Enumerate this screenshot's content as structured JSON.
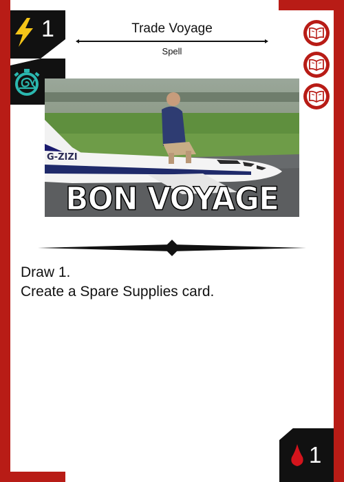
{
  "card": {
    "title": "Trade Voyage",
    "type": "Spell",
    "energy": "1",
    "cost": "1",
    "art_caption": "BON VOYAGE",
    "art_plane_marking": "G-ZIZI",
    "body_lines": [
      "Draw 1.",
      "Create a Spare Supplies card."
    ]
  },
  "icons": {
    "energy": "lightning-bolt-icon",
    "speed": "stopwatch-snail-icon",
    "badges": [
      "open-book-icon",
      "open-book-icon",
      "open-book-icon"
    ],
    "cost": "blood-drop-icon"
  },
  "colors": {
    "frame_red": "#b81c16",
    "panel_black": "#111111",
    "bolt_yellow": "#f5c518",
    "snail_teal": "#2bb8b0",
    "blood_red": "#d4141c"
  }
}
